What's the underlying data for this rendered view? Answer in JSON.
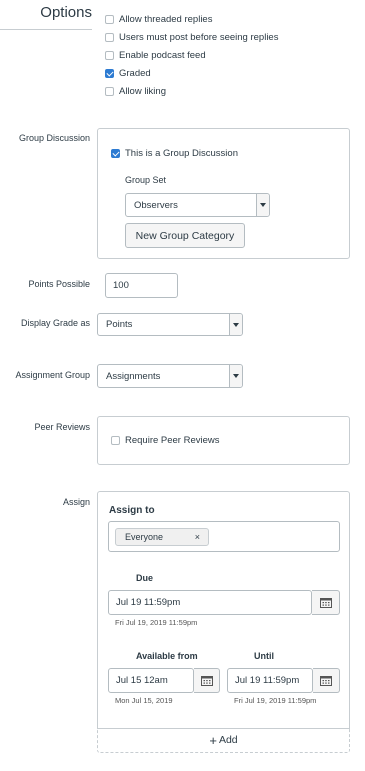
{
  "options": {
    "title": "Options",
    "checkboxes": [
      {
        "label": "Allow threaded replies",
        "checked": false
      },
      {
        "label": "Users must post before seeing replies",
        "checked": false
      },
      {
        "label": "Enable podcast feed",
        "checked": false
      },
      {
        "label": "Graded",
        "checked": true
      },
      {
        "label": "Allow liking",
        "checked": false
      }
    ]
  },
  "group_discussion": {
    "label": "Group Discussion",
    "checkbox_label": "This is a Group Discussion",
    "checked": true,
    "group_set_label": "Group Set",
    "group_set_value": "Observers",
    "new_category_button": "New Group Category"
  },
  "points_possible": {
    "label": "Points Possible",
    "value": "100"
  },
  "display_grade": {
    "label": "Display Grade as",
    "value": "Points"
  },
  "assignment_group": {
    "label": "Assignment Group",
    "value": "Assignments"
  },
  "peer_reviews": {
    "label": "Peer Reviews",
    "checkbox_label": "Require Peer Reviews",
    "checked": false
  },
  "assign": {
    "label": "Assign",
    "assign_to_label": "Assign to",
    "token": "Everyone",
    "token_remove": "×",
    "due_label": "Due",
    "due_value": "Jul 19 11:59pm",
    "due_hint": "Fri Jul 19, 2019 11:59pm",
    "available_from_label": "Available from",
    "available_from_value": "Jul 15 12am",
    "available_from_hint": "Mon Jul 15, 2019",
    "until_label": "Until",
    "until_value": "Jul 19 11:59pm",
    "until_hint": "Fri Jul 19, 2019 11:59pm",
    "add_label": "Add",
    "add_icon": "+"
  },
  "colors": {
    "accent": "#2d7bd2",
    "border": "#c7cdd1",
    "text": "#2d3b45"
  },
  "icons": [
    "calendar-icon",
    "plus-icon",
    "chevron-down-icon",
    "remove-icon"
  ]
}
